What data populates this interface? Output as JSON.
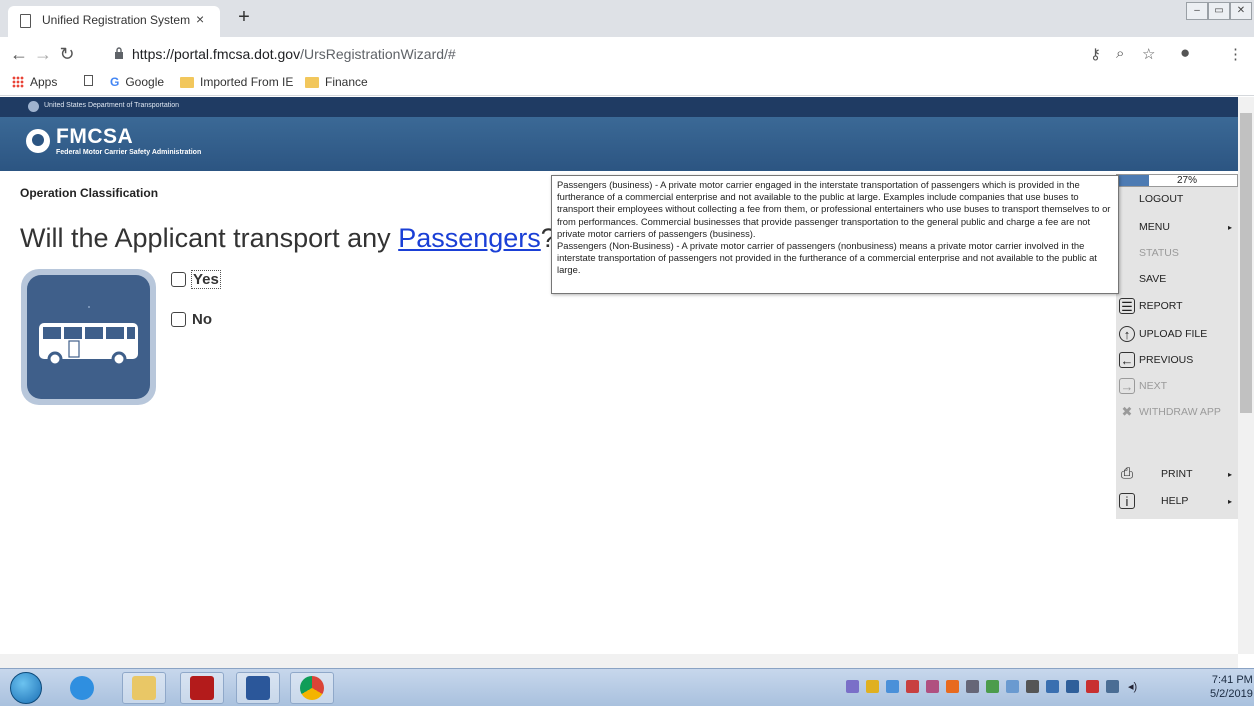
{
  "browser": {
    "tab_title": "Unified Registration System",
    "tab_close": "×",
    "new_tab": "+",
    "url_host": "https://portal.fmcsa.dot.gov",
    "url_path": "/UrsRegistrationWizard/#",
    "bookmarks": [
      "Apps",
      "Google",
      "Imported From IE",
      "Finance"
    ]
  },
  "page": {
    "dot_bar_text": "United States Department of Transportation",
    "brand_name": "FMCSA",
    "brand_sub": "Federal Motor Carrier Safety Administration",
    "section_title": "Operation Classification",
    "question_prefix": "Will the Applicant transport any ",
    "question_link": "Passengers",
    "question_suffix": "?",
    "options": [
      "Yes",
      "No"
    ]
  },
  "tooltip": {
    "text1": "Passengers (business) - A private motor carrier engaged in the interstate transportation of passengers which is provided in the furtherance of a commercial enterprise and not available to the public at large. Examples include companies that use buses to transport their employees without collecting a fee from them, or professional entertainers who use buses to transport themselves to or from performances. Commercial businesses that provide passenger transportation to the general public and charge a fee are not private motor carriers of passengers (business).",
    "text2": "Passengers (Non-Business) - A private motor carrier of passengers (nonbusiness) means a private motor carrier involved in the interstate transportation of passengers not provided in the furtherance of a commercial enterprise and not available to the public at large."
  },
  "menu": {
    "progress_label": "27%",
    "progress_value": 0.27,
    "items": {
      "logout": "LOGOUT",
      "menu": "MENU",
      "status": "STATUS",
      "save": "SAVE",
      "report": "REPORT",
      "upload": "UPLOAD FILE",
      "previous": "PREVIOUS",
      "next": "NEXT",
      "withdraw": "WITHDRAW APP",
      "print": "PRINT",
      "help": "HELP"
    }
  },
  "taskbar": {
    "time": "7:41 PM",
    "date": "5/2/2019"
  },
  "colors": {
    "header_blue": "#2c5582",
    "dot_bar": "#1f3b63",
    "link": "#1a3fd6",
    "menu_bg": "#e4e4e4"
  }
}
